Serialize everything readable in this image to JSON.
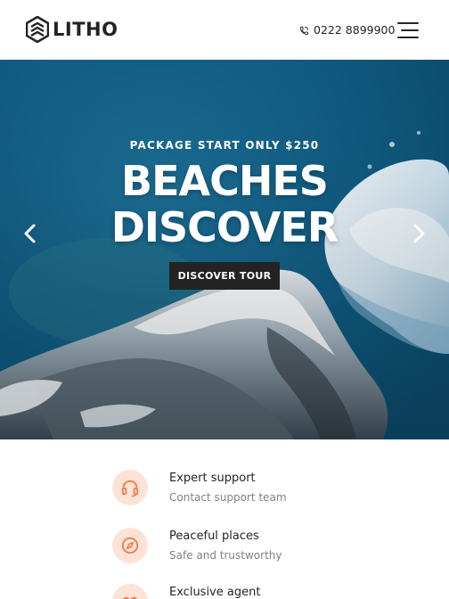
{
  "header": {
    "logo_text": "LITHO",
    "phone": "0222 8899900",
    "menu_icon": "hamburger-icon"
  },
  "hero": {
    "subtitle": "PACKAGE START ONLY $250",
    "title_line1": "BEACHES",
    "title_line2": "DISCOVER",
    "button_label": "DISCOVER TOUR",
    "prev_icon": "chevron-left-icon",
    "next_icon": "chevron-right-icon"
  },
  "features": [
    {
      "title": "Expert support",
      "description": "Contact support team",
      "icon": "headset-icon"
    },
    {
      "title": "Peaceful places",
      "description": "Safe and trustworthy",
      "icon": "compass-icon"
    },
    {
      "title": "Exclusive agent",
      "description": "",
      "icon": "handshake-icon"
    }
  ],
  "colors": {
    "dark": "#232323",
    "accent": "#f4794f",
    "accent_soft": "#fde3d6",
    "muted": "#828282",
    "hero_water": "#0f5d83"
  }
}
